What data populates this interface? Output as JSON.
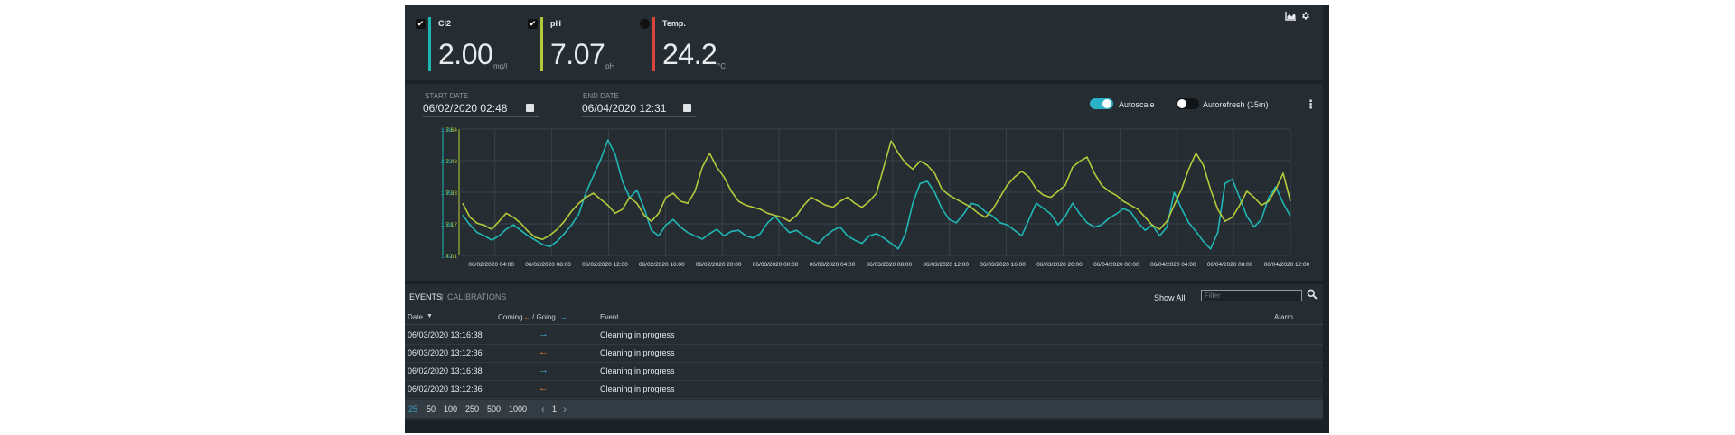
{
  "colors": {
    "cl2": "#1fb7b5",
    "ph": "#b5c93a",
    "temp": "#d9453d",
    "toggle_on": "#2ab3c7",
    "toggle_off": "#111417",
    "arrow_coming": "#ea7f2a",
    "arrow_going": "#39b6d6",
    "page_active": "#3aa3c7"
  },
  "icons": [
    "chart-icon",
    "gear-icon",
    "calendar-icon",
    "more-vert-icon",
    "search-icon",
    "check-icon",
    "sort-down-icon"
  ],
  "sensors": [
    {
      "name": "Cl2",
      "value": "2.00",
      "unit": "mg/l",
      "checked": true
    },
    {
      "name": "pH",
      "value": "7.07",
      "unit": "pH",
      "checked": true
    },
    {
      "name": "Temp.",
      "value": "24.2",
      "unit": "°C",
      "checked": false
    }
  ],
  "filters": {
    "start_label": "START DATE",
    "start_value": "06/02/2020 02:48",
    "end_label": "END DATE",
    "end_value": "06/04/2020 12:31",
    "autoscale_label": "Autoscale",
    "autoscale_on": true,
    "autorefresh_label": "Autorefresh (15m)",
    "autorefresh_on": false
  },
  "chart_data": {
    "type": "line",
    "ylim_left": [
      1.42,
      2.58
    ],
    "yticks_left": [
      "1.58",
      "2.23",
      "1.95",
      "1.58",
      "1.42"
    ],
    "ylim_right": [
      7.01,
      7.64
    ],
    "yticks_right": [
      "7.64",
      "7.48",
      "7.33",
      "7.17",
      "7.01"
    ],
    "x_labels": [
      "06/02/2020 04:00",
      "06/02/2020 08:00",
      "06/02/2020 12:00",
      "06/02/2020 16:00",
      "06/02/2020 20:00",
      "06/03/2020 00:00",
      "06/03/2020 04:00",
      "06/03/2020 08:00",
      "06/03/2020 12:00",
      "06/03/2020 16:00",
      "06/03/2020 20:00",
      "06/04/2020 00:00",
      "06/04/2020 04:00",
      "06/04/2020 08:00",
      "06/04/2020 12:00"
    ],
    "grid": true,
    "series": [
      {
        "name": "Cl2",
        "axis": "left",
        "values": [
          1.79,
          1.7,
          1.63,
          1.6,
          1.56,
          1.6,
          1.66,
          1.7,
          1.65,
          1.6,
          1.56,
          1.52,
          1.5,
          1.55,
          1.62,
          1.7,
          1.8,
          2.0,
          2.15,
          2.3,
          2.48,
          2.35,
          2.1,
          1.95,
          2.02,
          1.85,
          1.65,
          1.6,
          1.7,
          1.75,
          1.68,
          1.63,
          1.6,
          1.57,
          1.62,
          1.66,
          1.6,
          1.64,
          1.65,
          1.6,
          1.58,
          1.62,
          1.72,
          1.78,
          1.7,
          1.63,
          1.65,
          1.6,
          1.56,
          1.53,
          1.6,
          1.65,
          1.68,
          1.6,
          1.56,
          1.53,
          1.6,
          1.62,
          1.58,
          1.53,
          1.48,
          1.62,
          1.9,
          2.08,
          2.1,
          2.0,
          1.85,
          1.75,
          1.72,
          1.8,
          1.9,
          1.88,
          1.82,
          1.78,
          1.72,
          1.7,
          1.65,
          1.6,
          1.75,
          1.9,
          1.85,
          1.8,
          1.7,
          1.78,
          1.9,
          1.8,
          1.72,
          1.68,
          1.7,
          1.76,
          1.8,
          1.85,
          1.82,
          1.72,
          1.65,
          1.7,
          1.6,
          1.68,
          2.0,
          1.85,
          1.72,
          1.64,
          1.55,
          1.48,
          1.63,
          2.08,
          2.12,
          1.95,
          1.78,
          1.68,
          1.75,
          1.95,
          2.05,
          1.9,
          1.78
        ]
      },
      {
        "name": "pH",
        "axis": "right",
        "values": [
          7.27,
          7.2,
          7.17,
          7.16,
          7.14,
          7.18,
          7.22,
          7.2,
          7.17,
          7.13,
          7.1,
          7.09,
          7.11,
          7.14,
          7.18,
          7.23,
          7.27,
          7.3,
          7.32,
          7.29,
          7.26,
          7.22,
          7.24,
          7.3,
          7.27,
          7.21,
          7.18,
          7.22,
          7.3,
          7.32,
          7.28,
          7.27,
          7.33,
          7.45,
          7.52,
          7.45,
          7.4,
          7.33,
          7.28,
          7.26,
          7.25,
          7.24,
          7.22,
          7.21,
          7.2,
          7.18,
          7.21,
          7.26,
          7.3,
          7.28,
          7.26,
          7.25,
          7.28,
          7.3,
          7.27,
          7.25,
          7.28,
          7.32,
          7.45,
          7.58,
          7.52,
          7.47,
          7.44,
          7.48,
          7.46,
          7.42,
          7.34,
          7.31,
          7.29,
          7.27,
          7.25,
          7.22,
          7.2,
          7.24,
          7.3,
          7.36,
          7.4,
          7.43,
          7.4,
          7.34,
          7.31,
          7.3,
          7.33,
          7.36,
          7.45,
          7.48,
          7.5,
          7.42,
          7.36,
          7.33,
          7.31,
          7.28,
          7.26,
          7.24,
          7.2,
          7.16,
          7.14,
          7.18,
          7.26,
          7.34,
          7.44,
          7.52,
          7.46,
          7.34,
          7.24,
          7.18,
          7.2,
          7.26,
          7.33,
          7.3,
          7.26,
          7.28,
          7.34,
          7.42,
          7.28
        ]
      }
    ]
  },
  "events": {
    "tab_events": "EVENTS",
    "separator": "|",
    "tab_calibrations": "CALIBRATIONS",
    "show_all": "Show All",
    "filter_placeholder": "Filter",
    "columns": {
      "date": "Date",
      "coming": "Coming",
      "going": "/ Going",
      "event": "Event",
      "alarm": "Alarm"
    },
    "rows": [
      {
        "date": "06/03/2020 13:16:38",
        "arrow": "→",
        "direction": "going",
        "event": "Cleaning in progress"
      },
      {
        "date": "06/03/2020 13:12:36",
        "arrow": "←",
        "direction": "coming",
        "event": "Cleaning in progress"
      },
      {
        "date": "06/02/2020 13:16:38",
        "arrow": "→",
        "direction": "going",
        "event": "Cleaning in progress"
      },
      {
        "date": "06/02/2020 13:12:36",
        "arrow": "←",
        "direction": "coming",
        "event": "Cleaning in progress"
      }
    ],
    "page_sizes": [
      "25",
      "50",
      "100",
      "250",
      "500",
      "1000"
    ],
    "page_size_selected": "25",
    "page_prev": "‹",
    "page_current": "1",
    "page_next": "›"
  }
}
